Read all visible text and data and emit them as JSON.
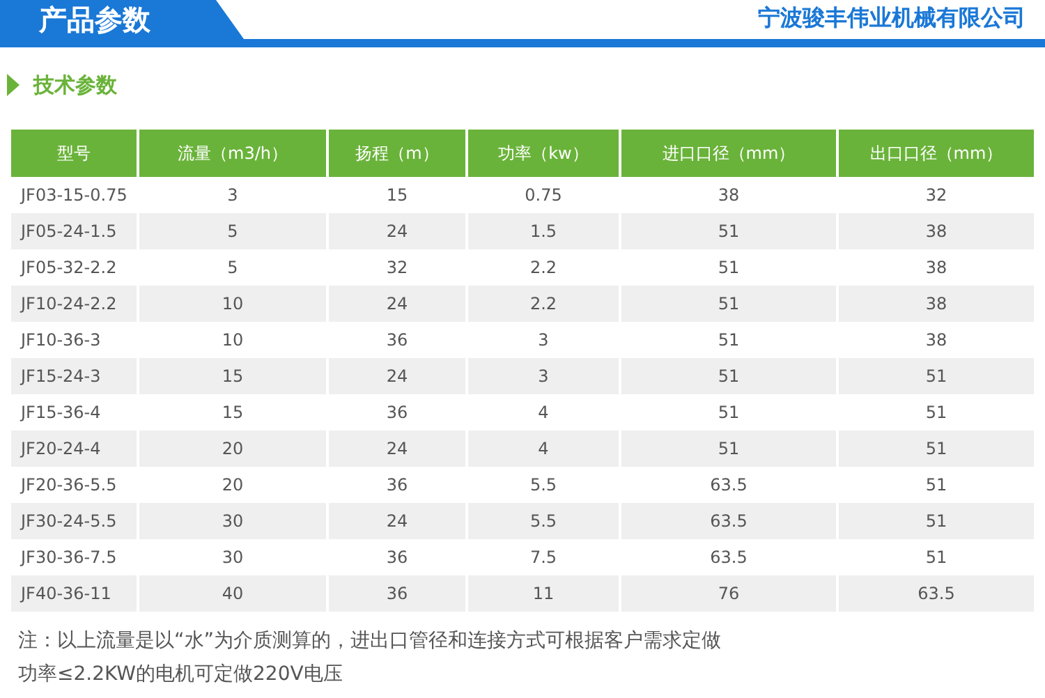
{
  "header": {
    "title": "产品参数",
    "company": "宁波骏丰伟业机械有限公司"
  },
  "section": {
    "title": "技术参数"
  },
  "table": {
    "columns": [
      "型号",
      "流量（m3/h）",
      "扬程（m）",
      "功率（kw）",
      "进口口径（mm）",
      "出口口径（mm）"
    ],
    "rows": [
      [
        "JF03-15-0.75",
        "3",
        "15",
        "0.75",
        "38",
        "32"
      ],
      [
        "JF05-24-1.5",
        "5",
        "24",
        "1.5",
        "51",
        "38"
      ],
      [
        "JF05-32-2.2",
        "5",
        "32",
        "2.2",
        "51",
        "38"
      ],
      [
        "JF10-24-2.2",
        "10",
        "24",
        "2.2",
        "51",
        "38"
      ],
      [
        "JF10-36-3",
        "10",
        "36",
        "3",
        "51",
        "38"
      ],
      [
        "JF15-24-3",
        "15",
        "24",
        "3",
        "51",
        "51"
      ],
      [
        "JF15-36-4",
        "15",
        "36",
        "4",
        "51",
        "51"
      ],
      [
        "JF20-24-4",
        "20",
        "24",
        "4",
        "51",
        "51"
      ],
      [
        "JF20-36-5.5",
        "20",
        "36",
        "5.5",
        "63.5",
        "51"
      ],
      [
        "JF30-24-5.5",
        "30",
        "24",
        "5.5",
        "63.5",
        "51"
      ],
      [
        "JF30-36-7.5",
        "30",
        "36",
        "7.5",
        "63.5",
        "51"
      ],
      [
        "JF40-36-11",
        "40",
        "36",
        "11",
        "76",
        "63.5"
      ]
    ]
  },
  "notes": [
    "注：以上流量是以“水”为介质测算的，进出口管径和连接方式可根据客户需求定做",
    "功率≤2.2KW的电机可定做220V电压"
  ]
}
